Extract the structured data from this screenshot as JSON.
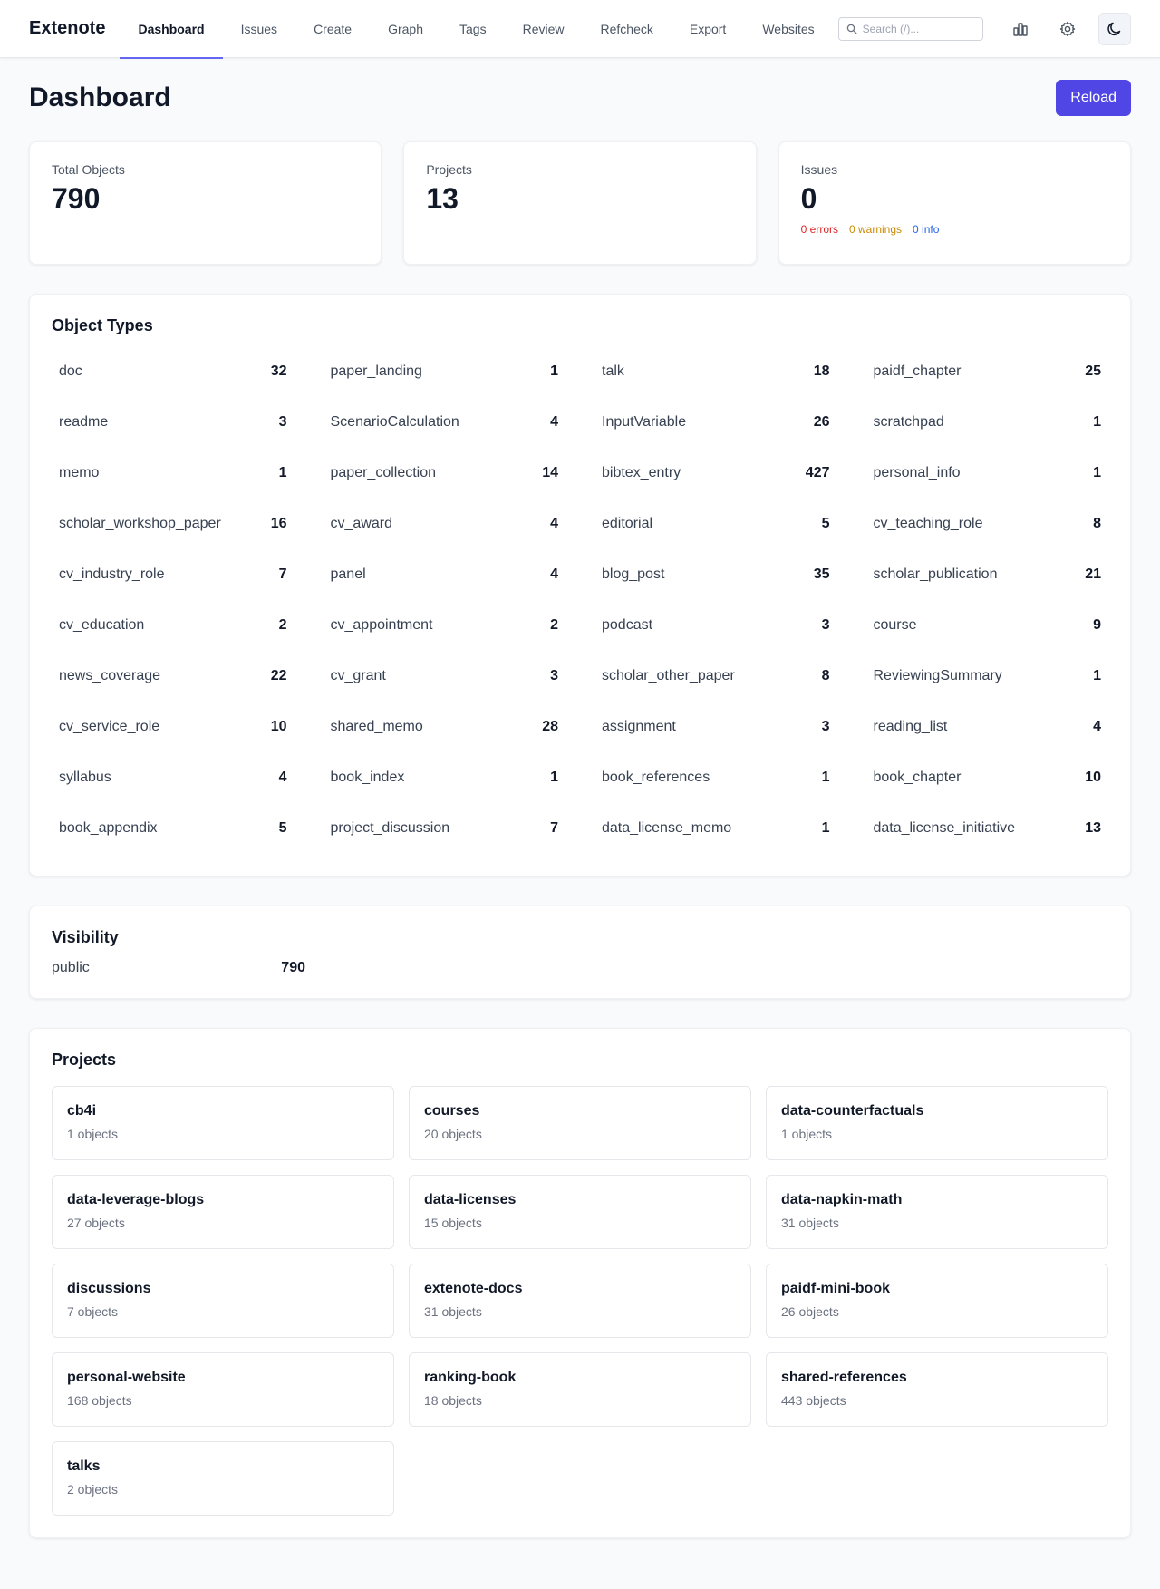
{
  "header": {
    "brand": "Extenote",
    "nav": [
      {
        "label": "Dashboard",
        "active": true
      },
      {
        "label": "Issues"
      },
      {
        "label": "Create"
      },
      {
        "label": "Graph"
      },
      {
        "label": "Tags"
      },
      {
        "label": "Review"
      },
      {
        "label": "Refcheck"
      },
      {
        "label": "Export"
      },
      {
        "label": "Websites"
      }
    ],
    "search": {
      "placeholder": "Search (/)...",
      "value": ""
    },
    "icons": [
      "bar-chart-icon",
      "gear-icon",
      "moon-icon"
    ]
  },
  "page": {
    "title": "Dashboard",
    "reload_label": "Reload"
  },
  "stats": {
    "total_objects": {
      "label": "Total Objects",
      "value": "790"
    },
    "projects": {
      "label": "Projects",
      "value": "13"
    },
    "issues": {
      "label": "Issues",
      "value": "0",
      "errors": "0 errors",
      "warnings": "0 warnings",
      "info": "0 info"
    }
  },
  "colors": {
    "accent": "#4f46e5",
    "nav_underline": "#6366f1",
    "error": "#dc2626",
    "warning": "#ca8a04",
    "info": "#2563eb"
  },
  "object_types": {
    "title": "Object Types",
    "items": [
      {
        "name": "doc",
        "count": "32"
      },
      {
        "name": "paper_landing",
        "count": "1"
      },
      {
        "name": "talk",
        "count": "18"
      },
      {
        "name": "paidf_chapter",
        "count": "25"
      },
      {
        "name": "readme",
        "count": "3"
      },
      {
        "name": "ScenarioCalculation",
        "count": "4"
      },
      {
        "name": "InputVariable",
        "count": "26"
      },
      {
        "name": "scratchpad",
        "count": "1"
      },
      {
        "name": "memo",
        "count": "1"
      },
      {
        "name": "paper_collection",
        "count": "14"
      },
      {
        "name": "bibtex_entry",
        "count": "427"
      },
      {
        "name": "personal_info",
        "count": "1"
      },
      {
        "name": "scholar_workshop_paper",
        "count": "16"
      },
      {
        "name": "cv_award",
        "count": "4"
      },
      {
        "name": "editorial",
        "count": "5"
      },
      {
        "name": "cv_teaching_role",
        "count": "8"
      },
      {
        "name": "cv_industry_role",
        "count": "7"
      },
      {
        "name": "panel",
        "count": "4"
      },
      {
        "name": "blog_post",
        "count": "35"
      },
      {
        "name": "scholar_publication",
        "count": "21"
      },
      {
        "name": "cv_education",
        "count": "2"
      },
      {
        "name": "cv_appointment",
        "count": "2"
      },
      {
        "name": "podcast",
        "count": "3"
      },
      {
        "name": "course",
        "count": "9"
      },
      {
        "name": "news_coverage",
        "count": "22"
      },
      {
        "name": "cv_grant",
        "count": "3"
      },
      {
        "name": "scholar_other_paper",
        "count": "8"
      },
      {
        "name": "ReviewingSummary",
        "count": "1"
      },
      {
        "name": "cv_service_role",
        "count": "10"
      },
      {
        "name": "shared_memo",
        "count": "28"
      },
      {
        "name": "assignment",
        "count": "3"
      },
      {
        "name": "reading_list",
        "count": "4"
      },
      {
        "name": "syllabus",
        "count": "4"
      },
      {
        "name": "book_index",
        "count": "1"
      },
      {
        "name": "book_references",
        "count": "1"
      },
      {
        "name": "book_chapter",
        "count": "10"
      },
      {
        "name": "book_appendix",
        "count": "5"
      },
      {
        "name": "project_discussion",
        "count": "7"
      },
      {
        "name": "data_license_memo",
        "count": "1"
      },
      {
        "name": "data_license_initiative",
        "count": "13"
      }
    ]
  },
  "visibility": {
    "title": "Visibility",
    "items": [
      {
        "name": "public",
        "count": "790"
      }
    ]
  },
  "projects": {
    "title": "Projects",
    "items": [
      {
        "name": "cb4i",
        "count": "1 objects"
      },
      {
        "name": "courses",
        "count": "20 objects"
      },
      {
        "name": "data-counterfactuals",
        "count": "1 objects"
      },
      {
        "name": "data-leverage-blogs",
        "count": "27 objects"
      },
      {
        "name": "data-licenses",
        "count": "15 objects"
      },
      {
        "name": "data-napkin-math",
        "count": "31 objects"
      },
      {
        "name": "discussions",
        "count": "7 objects"
      },
      {
        "name": "extenote-docs",
        "count": "31 objects"
      },
      {
        "name": "paidf-mini-book",
        "count": "26 objects"
      },
      {
        "name": "personal-website",
        "count": "168 objects"
      },
      {
        "name": "ranking-book",
        "count": "18 objects"
      },
      {
        "name": "shared-references",
        "count": "443 objects"
      },
      {
        "name": "talks",
        "count": "2 objects"
      }
    ]
  }
}
